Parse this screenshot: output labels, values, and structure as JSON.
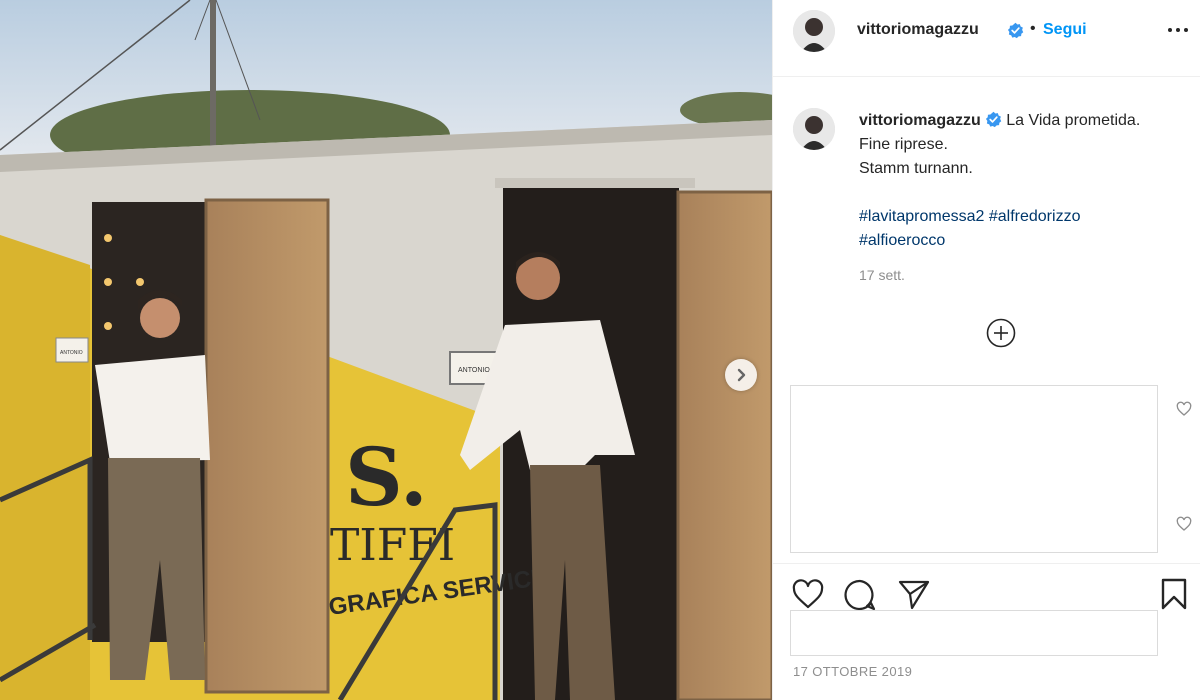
{
  "post": {
    "username": "vittoriomagazzu",
    "follow_label": "Segui",
    "dot_separator": "•",
    "caption": {
      "line1": "La Vida prometida.",
      "line2": "Fine riprese.",
      "line3": "Stamm turnann."
    },
    "hashtags": [
      "#lavitapromessa2",
      "#alfredorizzo",
      "#alfioerocco"
    ],
    "comment_age": "17 sett.",
    "timestamp": "17 OTTOBRE 2019"
  },
  "photo": {
    "sign_left": "ANTONIO",
    "sign_center": "ANTONIO",
    "truck_brand": "TIFFI",
    "truck_subtitle": "GRAFICA SERVICE",
    "truck_logo": "S."
  },
  "icons": {
    "verified": "verified-badge-icon",
    "more": "more-options-icon",
    "add_comment": "plus-circle-icon",
    "like": "heart-icon",
    "comment": "comment-bubble-icon",
    "share": "paper-plane-icon",
    "save": "bookmark-icon",
    "next": "chevron-right-icon"
  },
  "colors": {
    "link": "#00376b",
    "follow": "#0095f6",
    "verified": "#3897f0",
    "secondary_text": "#8e8e8e"
  }
}
